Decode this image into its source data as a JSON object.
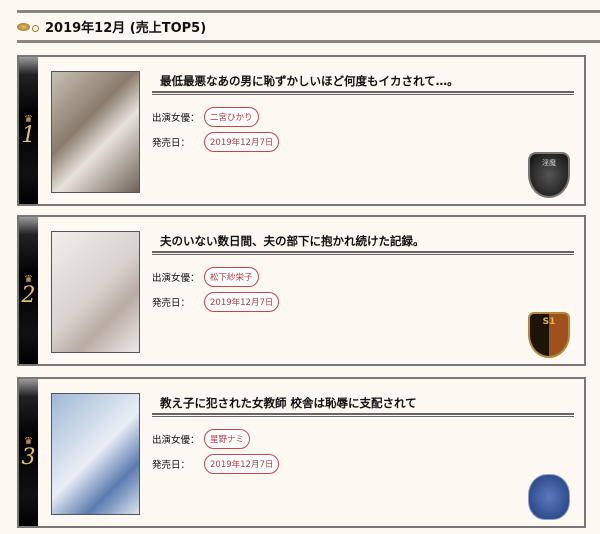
{
  "header": {
    "title": "2019年12月 (売上TOP5)",
    "icon": "ornament-icon"
  },
  "labels": {
    "actress": "出演女優：",
    "release": "発売日："
  },
  "items": [
    {
      "rank": "1",
      "title": "最低最悪なあの男に恥ずかしいほど何度もイカされて…。",
      "actress": "二宮ひかり",
      "release": "2019年12月7日",
      "logo_text": "淫魔"
    },
    {
      "rank": "2",
      "title": "夫のいない数日間、夫の部下に抱かれ続けた記録。",
      "actress": "松下紗栄子",
      "release": "2019年12月7日",
      "logo_text": "S1"
    },
    {
      "rank": "3",
      "title": "教え子に犯された女教師 校舎は恥辱に支配されて",
      "actress": "星野ナミ",
      "release": "2019年12月7日"
    }
  ]
}
